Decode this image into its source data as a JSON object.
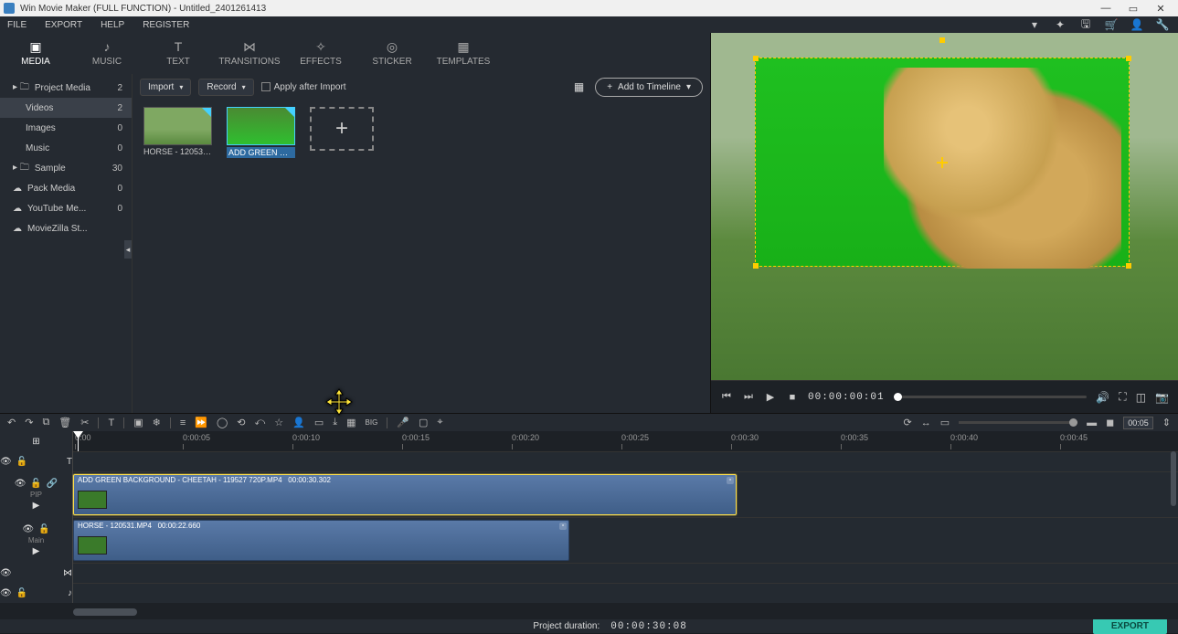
{
  "titlebar": {
    "title": "Win Movie Maker (FULL FUNCTION) - Untitled_2401261413"
  },
  "menu": {
    "file": "FILE",
    "export": "EXPORT",
    "help": "HELP",
    "register": "REGISTER"
  },
  "maintabs": [
    "MEDIA",
    "MUSIC",
    "TEXT",
    "TRANSITIONS",
    "EFFECTS",
    "STICKER",
    "TEMPLATES"
  ],
  "sidebar": {
    "items": [
      {
        "label": "Project Media",
        "count": "2",
        "folder": true
      },
      {
        "label": "Videos",
        "count": "2",
        "indent": true,
        "selected": true
      },
      {
        "label": "Images",
        "count": "0",
        "indent": true
      },
      {
        "label": "Music",
        "count": "0",
        "indent": true
      },
      {
        "label": "Sample",
        "count": "30",
        "folder": true
      },
      {
        "label": "Pack Media",
        "count": "0",
        "cloud": true
      },
      {
        "label": "YouTube Me...",
        "count": "0",
        "cloud": true
      },
      {
        "label": "MovieZilla St...",
        "cloud": true
      }
    ]
  },
  "topstrip": {
    "import": "Import",
    "record": "Record",
    "apply": "Apply after Import",
    "add": "Add to Timeline"
  },
  "thumbs": [
    {
      "label": "HORSE - 120531...",
      "kind": "horse"
    },
    {
      "label": "ADD GREEN BAC...",
      "kind": "cheetah",
      "selected": true
    }
  ],
  "player": {
    "timecode": "00:00:00:01",
    "duration": "00:05"
  },
  "ruler": [
    "0:00",
    "0:00:05",
    "0:00:10",
    "0:00:15",
    "0:00:20",
    "0:00:25",
    "0:00:30",
    "0:00:35",
    "0:00:40",
    "0:00:45"
  ],
  "clips": {
    "pip": {
      "title": "ADD GREEN BACKGROUND - CHEETAH - 119527 720P.MP4",
      "dur": "00:00:30.302"
    },
    "main": {
      "title": "HORSE - 120531.MP4",
      "dur": "00:00:22.660"
    }
  },
  "tracks": {
    "pip": "PIP",
    "main": "Main"
  },
  "footer": {
    "projdur_label": "Project duration:",
    "projdur": "00:00:30:08",
    "export": "EXPORT"
  },
  "zoom": "00:05"
}
